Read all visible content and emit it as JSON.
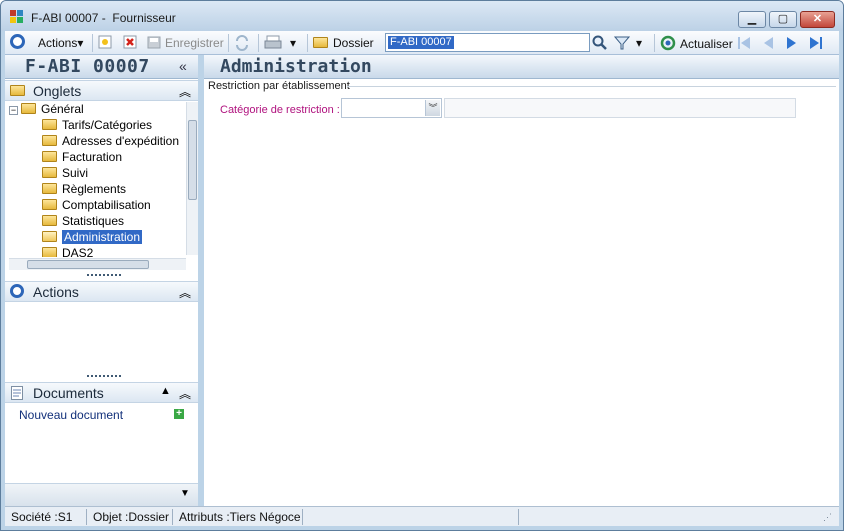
{
  "window": {
    "code": "F-ABI 00007",
    "title_sep": "-",
    "subtitle": "Fournisseur",
    "controls": [
      "minimize",
      "maximize",
      "close"
    ]
  },
  "toolbar": {
    "actions_label": "Actions",
    "save_label": "Enregistrer",
    "dossier_label": "Dossier",
    "search_value": "F-ABI 00007",
    "refresh_label": "Actualiser"
  },
  "sidebar": {
    "header_title": "F-ABI 00007",
    "collapse_glyph": "«",
    "onglets_label": "Onglets",
    "tree": {
      "root": "Général",
      "items": [
        "Tarifs/Catégories",
        "Adresses d'expédition",
        "Facturation",
        "Suivi",
        "Règlements",
        "Comptabilisation",
        "Statistiques",
        "Administration",
        "DAS2"
      ],
      "selected_index": 7
    },
    "actions_label": "Actions",
    "documents_label": "Documents",
    "new_document_label": "Nouveau document"
  },
  "main": {
    "title": "Administration",
    "group_title": "Restriction par établissement",
    "field_label": "Catégorie de restriction :",
    "field_value": "",
    "field_description": ""
  },
  "statusbar": {
    "societe": "Société :S1",
    "objet": "Objet :Dossier",
    "attributs": "Attributs :Tiers Négoce"
  },
  "colors": {
    "accent": "#3169c6",
    "field_label": "#b0127e",
    "frame": "#bcd3e7"
  }
}
